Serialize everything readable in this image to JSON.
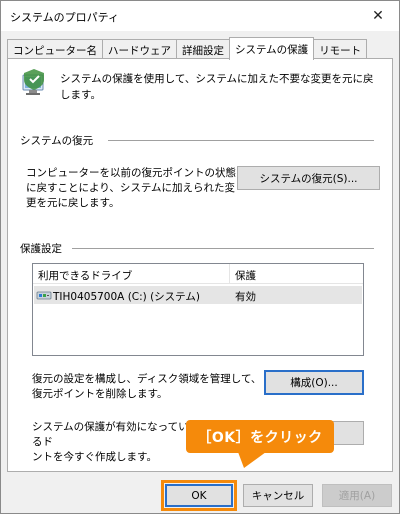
{
  "window": {
    "title": "システムのプロパティ",
    "close_glyph": "✕"
  },
  "tabs": [
    {
      "label": "コンピューター名"
    },
    {
      "label": "ハードウェア"
    },
    {
      "label": "詳細設定"
    },
    {
      "label": "システムの保護"
    },
    {
      "label": "リモート"
    }
  ],
  "intro": {
    "text": "システムの保護を使用して、システムに加えた不要な変更を元に戻します。"
  },
  "restore": {
    "heading": "システムの復元",
    "description": "コンピューターを以前の復元ポイントの状態に戻すことにより、システムに加えられた変更を元に戻します。",
    "button_label": "システムの復元(S)..."
  },
  "protection": {
    "heading": "保護設定",
    "columns": [
      "利用できるドライブ",
      "保護"
    ],
    "rows": [
      {
        "drive": "TIH0405700A (C:) (システム)",
        "status": "有効"
      }
    ],
    "configure_text": "復元の設定を構成し、ディスク領域を管理して、復元ポイントを削除します。",
    "configure_button": "構成(O)...",
    "create_text": "システムの保護が有効になっているドライブの復元ポイントを今すぐ作成します。",
    "create_text_visible": "システムの保護が有効になっているド",
    "create_text_line2": "ントを今すぐ作成します。"
  },
  "footer": {
    "ok": "OK",
    "cancel": "キャンセル",
    "apply": "適用(A)"
  },
  "callout": {
    "text": "［OK］をクリック"
  },
  "colors": {
    "accent": "#f58a0b",
    "focus": "#2a6fc9"
  },
  "icons": {
    "shield": "system-protection-shield-icon",
    "drive": "drive-icon",
    "close": "close-icon"
  }
}
